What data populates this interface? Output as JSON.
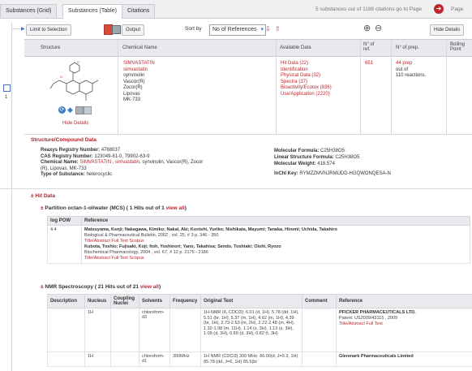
{
  "tabs": [
    {
      "label": "Substances (Grid)"
    },
    {
      "label": "Substances (Table)"
    },
    {
      "label": "Citations"
    }
  ],
  "status": {
    "text": "5 substances out of 1188 citations  go to Page",
    "page_label": "Page"
  },
  "toolbar": {
    "limit_label": "Limit to Selection",
    "output_label": "Output",
    "sort_by_label": "Sort by",
    "sort_value": "No of References",
    "hide_details_label": "Hide Details"
  },
  "columns": {
    "structure": "Structure",
    "chemical_name": "Chemical Name",
    "available_data": "Available Data",
    "n_ref": "N° of ref.",
    "n_prep": "N° of prep.",
    "boiling": "Boiling Point"
  },
  "row": {
    "index": "1",
    "names": [
      "SIMVASTATIN",
      "simvastatin",
      "synvinolin",
      "Vascor(R)",
      "Zocor(R)",
      "Lipovas",
      "MK-733"
    ],
    "available": [
      "Hit Data (22)",
      "Identification",
      "Physical Data (32)",
      "Spectra (37)",
      "Bioactivity/Ecotox (836)",
      "Use/Application (2220)"
    ],
    "n_ref": "651",
    "prep": [
      "44 prep",
      "out of",
      "110 reactions."
    ],
    "hide_details": "Hide Details"
  },
  "details": {
    "title": "Structure/Compound Data",
    "reaxys_label": "Reaxys Registry Number:",
    "reaxys": "4768037",
    "cas_label": "CAS Registry Number:",
    "cas": "123049-81-0, 79902-63-9",
    "chem_label": "Chemical Name:",
    "chem_red": "SIMVASTATIN , simvastatin",
    "chem_rest": ", synvinolin, Vascor(R), Zocor",
    "chem_rest2": "(R), Lipovas, MK-733",
    "type_label": "Type of Substance:",
    "type": "heterocyclic",
    "mf_label": "Molecular Formula:",
    "mf": "C25H38O5",
    "lsf_label": "Linear Structure Formula:",
    "lsf": "C25H38O5",
    "mw_label": "Molecular Weight:",
    "mw": "418.574",
    "inchi_label": "InChI Key:",
    "inchi": "RYMZZMVNJRMUDD-HGQWONQESA-N"
  },
  "hit_data": {
    "title": "Hit Data",
    "partition": {
      "title": "Partition octan-1-ol/water (MCS)",
      "count": "( 1 Hits out of 1",
      "view_all": "view all",
      "close": ")",
      "headers": [
        "log POW",
        "Reference"
      ],
      "value": "4.4",
      "refs": [
        {
          "authors": "Matsuyama, Kenji; Nakagawa, Kimiko; Nakai, Aki; Konishi, Yuriko; Nishikata, Mayumi; Tanaka, Hiromi; Uchida, Takahiro",
          "journal": "Biological & Pharmaceutical Bulletin,  2002 , vol. 25, # 3  p. 346 - 350",
          "links": "Title/Abstract   Full Text    Scopus"
        },
        {
          "authors": "Kubota, Toshio; Fujisaki, Koji; Itoh, Yoshinori; Yano, Takahisa; Sendo, Toshiaki; Oishi, Ryozo",
          "journal": "Biochemical Pharmacology,  2004 , vol. 67, # 12  p. 2175 - 2186",
          "links": "Title/Abstract   Full Text    Scopus"
        }
      ]
    },
    "nmr": {
      "title": "NMR Spectroscopy",
      "count": "( 21 Hits out of 21",
      "view_all": "view all",
      "close": ")",
      "headers": [
        "Description",
        "Nucleus",
        "Coupling Nuclei",
        "Solvents",
        "Frequency",
        "Original Text",
        "Comment",
        "Reference"
      ],
      "rows": [
        {
          "nucleus": "1H",
          "solvents": "chloroform-d3",
          "frequency": "",
          "text": "1H-NMR (δ, CDCl3): 6.01 (d, 1H), 5.78 (dd, 1H), 5.51 (br, 1H), 5.37 (m, 1H), 4.62 (m, 1H), 4.39 (br, 1H), 2.73-2.63 (m, 2H), 2.22-2.48 (m, 4H), 1.32-1.98 (m, 11H), 1.14 (s, 3H), 1.13 (s, 3H), 1.09 (d, 3H), 0.89 (d, 3H), 0.82 (t, 3H)",
          "ref_title": "PFICKER PHARMACEUTICALS LTD.",
          "ref_patent": "Patent:  US2009/43115 , 2009",
          "ref_links": "Title/Abstract   Full Text"
        },
        {
          "nucleus": "1H",
          "solvents": "chloroform-d1",
          "frequency": "300MHz",
          "text": "1H NMR (CDCl3) 300 MHz: δ6.00(d, J=9.3, 1H) δ5.78 (dd, J=6, 1H) δ5.5(br",
          "ref_title": "Glenmark Pharmaceuticals Limited",
          "ref_patent": "",
          "ref_links": ""
        }
      ]
    }
  },
  "colors": {
    "accent": "#c0262c",
    "header_bg": "#e7e9ec",
    "blue": "#3f7dc7"
  }
}
